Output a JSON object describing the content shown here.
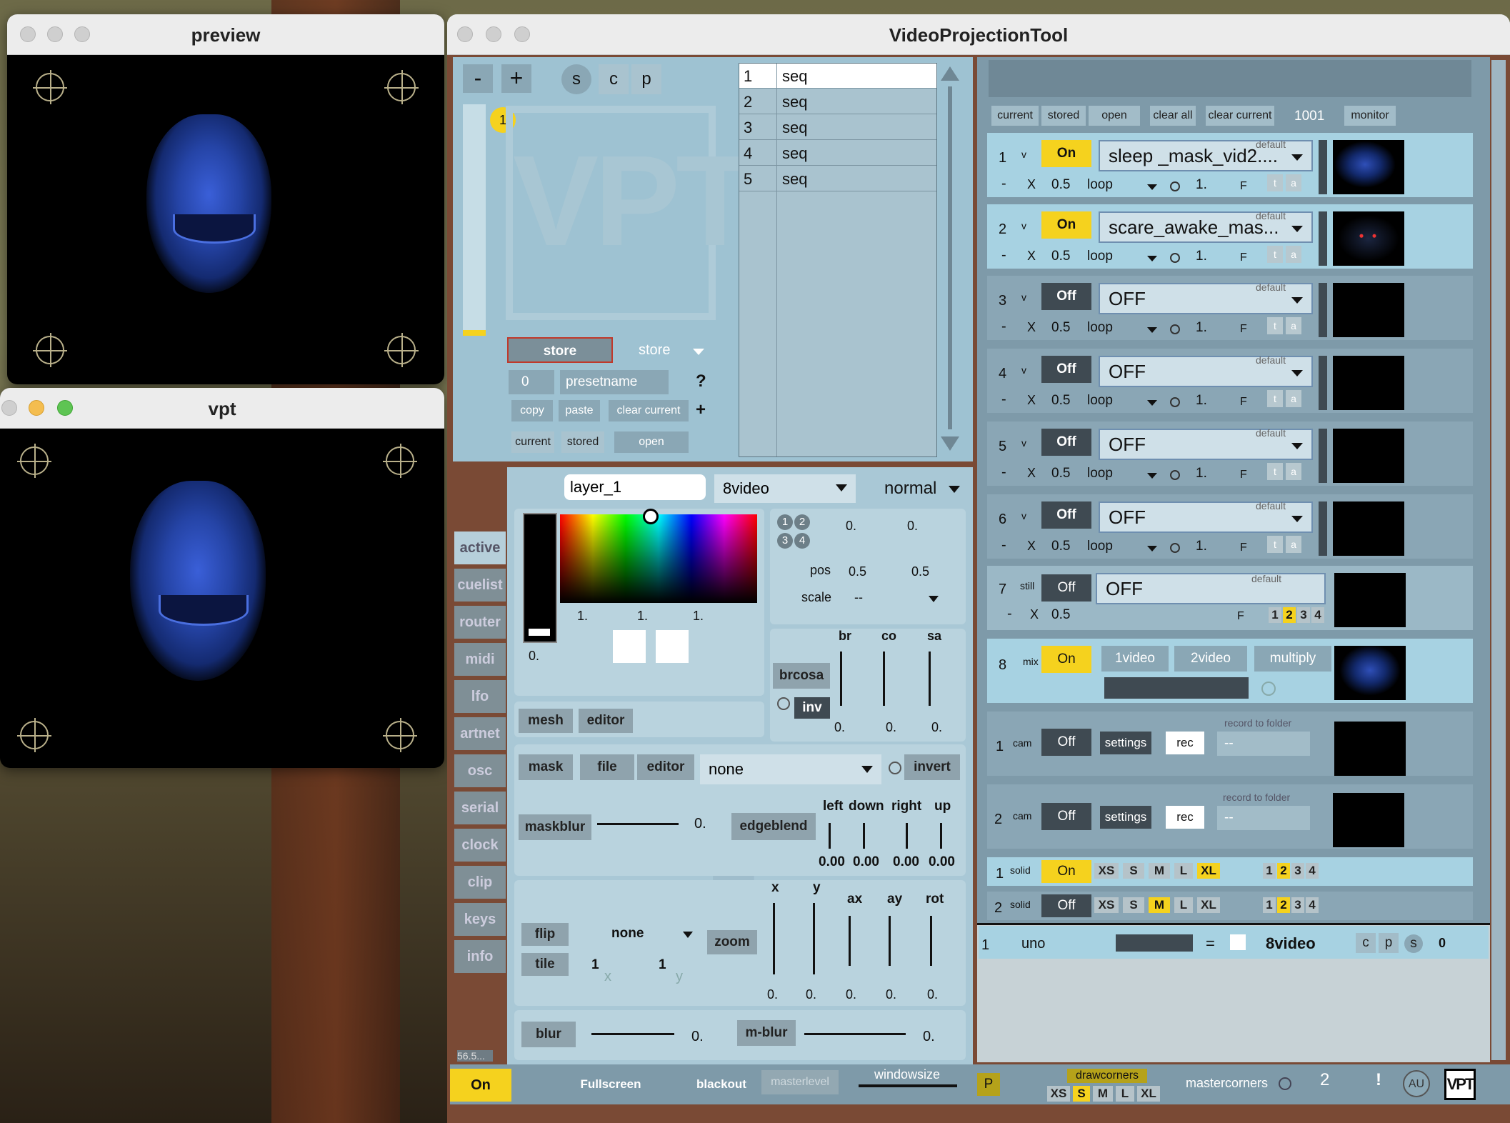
{
  "preview_window": {
    "title": "preview"
  },
  "vpt_window": {
    "title": "vpt"
  },
  "main_window": {
    "title": "VideoProjectionTool"
  },
  "preset": {
    "minus": "-",
    "plus": "+",
    "s": "s",
    "c": "c",
    "p": "p",
    "badge": "1",
    "logo": "VPT",
    "store_button": "store",
    "store_menu": "store",
    "number_value": "0",
    "name_placeholder": "presetname",
    "help": "?",
    "copy": "copy",
    "paste": "paste",
    "clear_current": "clear current",
    "add": "+",
    "current": "current",
    "stored": "stored",
    "open": "open",
    "list": [
      {
        "n": "1",
        "v": "seq"
      },
      {
        "n": "2",
        "v": "seq"
      },
      {
        "n": "3",
        "v": "seq"
      },
      {
        "n": "4",
        "v": "seq"
      },
      {
        "n": "5",
        "v": "seq"
      }
    ]
  },
  "tabs": [
    "active",
    "cuelist",
    "router",
    "midi",
    "lfo",
    "artnet",
    "osc",
    "serial",
    "clock",
    "clip",
    "keys",
    "info"
  ],
  "layer": {
    "name": "layer_1",
    "source": "8video",
    "blend": "normal",
    "color_value": "0.",
    "rgb": [
      "1.",
      "1.",
      "1."
    ],
    "quad": [
      "1",
      "2",
      "3",
      "4"
    ],
    "offset_x": "0.",
    "offset_y": "0.",
    "pos_label": "pos",
    "pos_x": "0.5",
    "pos_y": "0.5",
    "scale_label": "scale",
    "scale_value": "--",
    "brcosa": "brcosa",
    "inv": "inv",
    "br": "br",
    "co": "co",
    "sa": "sa",
    "br_v": "0.",
    "co_v": "0.",
    "sa_v": "0.",
    "mesh": "mesh",
    "editor": "editor",
    "mask": "mask",
    "file": "file",
    "mask_editor": "editor",
    "mask_select": "none",
    "invert": "invert",
    "maskblur": "maskblur",
    "maskblur_v": "0.",
    "edgeblend": "edgeblend",
    "left": "left",
    "down": "down",
    "right": "right",
    "up": "up",
    "left_v": "0.00",
    "down_v": "0.00",
    "right_v": "0.00",
    "up_v": "0.00",
    "flip": "flip",
    "flip_v": "none",
    "tile": "tile",
    "tile_x": "1",
    "tile_y": "1",
    "tile_xl": "x",
    "tile_yl": "y",
    "zoom": "zoom",
    "x": "x",
    "y": "y",
    "ax": "ax",
    "ay": "ay",
    "rot": "rot",
    "x_v": "0.",
    "y_v": "0.",
    "ax_v": "0.",
    "ay_v": "0.",
    "rot_v": "0.",
    "blur": "blur",
    "blur_v": "0.",
    "mblur": "m-blur",
    "mblur_v": "0.",
    "bignum": "1"
  },
  "mixer_top": {
    "current": "current",
    "stored": "stored",
    "open": "open",
    "clear_all": "clear all",
    "clear_current": "clear current",
    "count": "1001",
    "monitor": "monitor"
  },
  "slots": [
    {
      "n": "1",
      "type": "v",
      "state": "On",
      "file": "sleep _mask_vid2....",
      "speed": "0.5",
      "mode": "loop",
      "rate": "1.",
      "f": "F",
      "on": true
    },
    {
      "n": "2",
      "type": "v",
      "state": "On",
      "file": "scare_awake_mas...",
      "speed": "0.5",
      "mode": "loop",
      "rate": "1.",
      "f": "F",
      "on": true
    },
    {
      "n": "3",
      "type": "v",
      "state": "Off",
      "file": "OFF",
      "speed": "0.5",
      "mode": "loop",
      "rate": "1.",
      "f": "F",
      "on": false
    },
    {
      "n": "4",
      "type": "v",
      "state": "Off",
      "file": "OFF",
      "speed": "0.5",
      "mode": "loop",
      "rate": "1.",
      "f": "F",
      "on": false
    },
    {
      "n": "5",
      "type": "v",
      "state": "Off",
      "file": "OFF",
      "speed": "0.5",
      "mode": "loop",
      "rate": "1.",
      "f": "F",
      "on": false
    },
    {
      "n": "6",
      "type": "v",
      "state": "Off",
      "file": "OFF",
      "speed": "0.5",
      "mode": "loop",
      "rate": "1.",
      "f": "F",
      "on": false
    }
  ],
  "slot_labels": {
    "default": "default",
    "minus": "-",
    "x": "X",
    "t": "t",
    "a": "a"
  },
  "still": {
    "n": "7",
    "type": "still",
    "state": "Off",
    "file": "OFF",
    "speed": "0.5",
    "f": "F",
    "nums": [
      "1",
      "2",
      "3",
      "4"
    ]
  },
  "mix": {
    "n": "8",
    "type": "mix",
    "state": "On",
    "a": "1video",
    "b": "2video",
    "mode": "multiply"
  },
  "cams": [
    {
      "n": "1",
      "type": "cam",
      "state": "Off",
      "settings": "settings",
      "rec": "rec",
      "folder": "record to folder",
      "sel": "--"
    },
    {
      "n": "2",
      "type": "cam",
      "state": "Off",
      "settings": "settings",
      "rec": "rec",
      "folder": "record to folder",
      "sel": "--"
    }
  ],
  "solids": [
    {
      "n": "1",
      "type": "solid",
      "state": "On",
      "sizes": [
        "XS",
        "S",
        "M",
        "L",
        "XL"
      ],
      "nums": [
        "1",
        "2",
        "3",
        "4"
      ]
    },
    {
      "n": "2",
      "type": "solid",
      "state": "Off",
      "sizes": [
        "XS",
        "S",
        "M",
        "L",
        "XL"
      ],
      "nums": [
        "1",
        "2",
        "3",
        "4"
      ]
    }
  ],
  "output": {
    "n": "1",
    "name": "uno",
    "eq": "=",
    "src": "8video",
    "c": "c",
    "p": "p",
    "s": "s",
    "v": "0"
  },
  "bottom": {
    "fps": "56.5...",
    "on": "On",
    "fullscreen": "Fullscreen",
    "blackout": "blackout",
    "masterlevel": "masterlevel",
    "windowsize": "windowsize",
    "p": "P",
    "drawcorners": "drawcorners",
    "sizes": [
      "XS",
      "S",
      "M",
      "L",
      "XL"
    ],
    "mastercorners": "mastercorners",
    "two": "2",
    "bang": "!",
    "au": "AU",
    "logo": "VPT"
  },
  "colors": {
    "accent_yellow": "#f5d21e",
    "panel_blue": "#9ec2d2",
    "dark_button": "#3f4a52"
  }
}
